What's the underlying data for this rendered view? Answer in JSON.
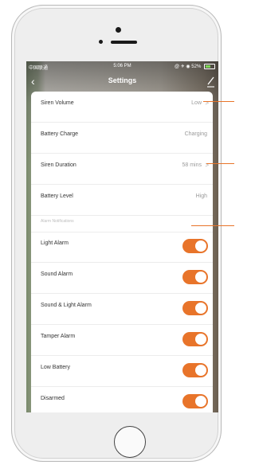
{
  "status_bar": {
    "carrier": "中国联通",
    "time": "5:06 PM",
    "right": "@ ✈ ◉ 52%"
  },
  "nav": {
    "title": "Settings"
  },
  "settings": [
    {
      "label": "Siren Volume",
      "value": "Low",
      "chevron": ">"
    },
    {
      "label": "Battery Charge",
      "value": "Charging"
    },
    {
      "label": "Siren Duration",
      "value": "58 mins",
      "chevron": ">"
    },
    {
      "label": "Battery Level",
      "value": "High"
    }
  ],
  "alarm_section": {
    "header": "Alarm Notifications",
    "toggles": [
      {
        "label": "Light Alarm",
        "on": true
      },
      {
        "label": "Sound Alarm",
        "on": true
      },
      {
        "label": "Sound & Light Alarm",
        "on": true
      },
      {
        "label": "Tamper Alarm",
        "on": true
      },
      {
        "label": "Low Battery",
        "on": true
      },
      {
        "label": "Disarmed",
        "on": true
      }
    ]
  },
  "colors": {
    "accent": "#e8742a",
    "label": "#333333",
    "value": "#9a9a9a"
  },
  "icons": {
    "back": "chevron-left-icon",
    "edit": "pencil-icon",
    "battery": "battery-icon"
  }
}
